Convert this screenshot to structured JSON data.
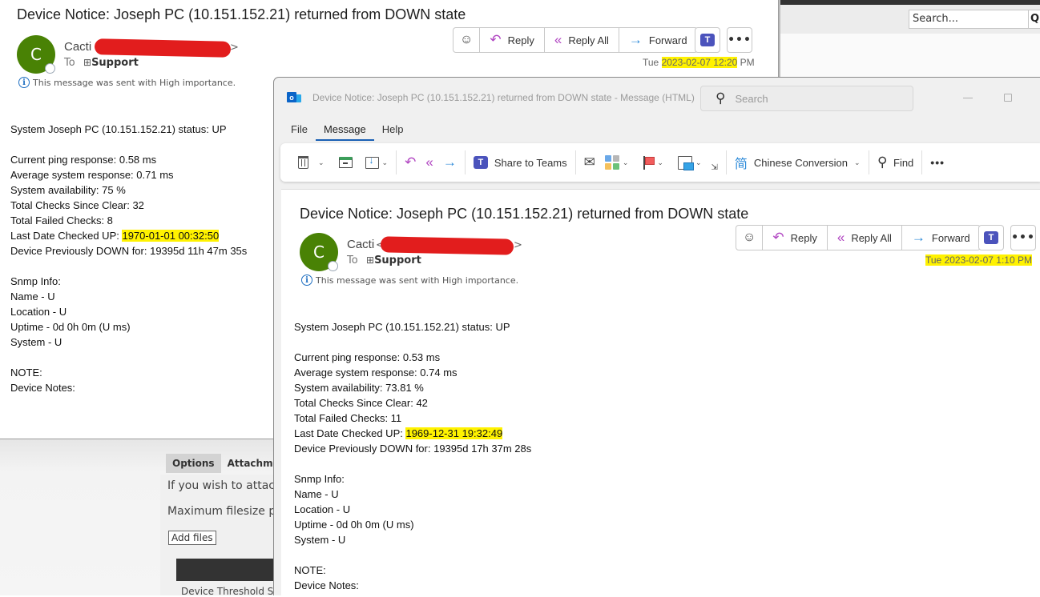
{
  "background_web_page": {
    "search_placeholder": "Search...",
    "search_button_glyph": "Q",
    "tabs": [
      "Options",
      "Attachments"
    ],
    "attach_text": "If you wish to attach",
    "filesize_text": "Maximum filesize pe",
    "add_files_label": "Add files",
    "threshold_text": "Device Threshold Se"
  },
  "back_message": {
    "subject": "Device Notice: Joseph PC (10.151.152.21) returned from DOWN state",
    "avatar_initial": "C",
    "sender_name": "Cacti",
    "sender_email_suffix": ">",
    "to_label": "To",
    "recipient_expand": "⊞",
    "recipient": "Support",
    "importance_note": "This message was sent with High importance.",
    "actions": {
      "emoji": "☺",
      "reply": "Reply",
      "reply_all": "Reply All",
      "forward": "Forward",
      "teams": "T",
      "more": "•••"
    },
    "date_prefix": "Tue ",
    "date_highlighted": "2023-02-07 12:20",
    "date_suffix": " PM",
    "body": {
      "status_line": "System Joseph PC (10.151.152.21) status: UP",
      "ping": "Current ping response: 0.58 ms",
      "avg": "Average system response: 0.71 ms",
      "availability": "System availability: 75 %",
      "total_checks": "Total Checks Since Clear: 32",
      "failed_checks": "Total Failed Checks: 8",
      "last_checked_label": "Last Date Checked UP: ",
      "last_checked_value": "1970-01-01 00:32:50",
      "prev_down": "Device Previously DOWN for: 19395d 11h 47m 35s",
      "snmp_header": "Snmp Info:",
      "snmp_name": "Name - U",
      "snmp_location": "Location - U",
      "snmp_uptime": "Uptime - 0d 0h 0m (U ms)",
      "snmp_system": "System - U",
      "note": "NOTE:",
      "device_notes": "Device Notes:"
    }
  },
  "outlook_window": {
    "title": "Device Notice: Joseph PC (10.151.152.21) returned from DOWN state  -  Message (HTML)",
    "search_placeholder": "Search",
    "menu": [
      "File",
      "Message",
      "Help"
    ],
    "active_menu": "Message",
    "ribbon": {
      "share_to_teams": "Share to Teams",
      "chinese_conversion": "Chinese Conversion",
      "find": "Find",
      "more": "•••"
    },
    "message": {
      "subject": "Device Notice: Joseph PC (10.151.152.21) returned from DOWN state",
      "avatar_initial": "C",
      "sender_name": "Cacti",
      "sender_email_prefix": "<",
      "sender_email_suffix": ">",
      "to_label": "To",
      "recipient_expand": "⊞",
      "recipient": "Support",
      "importance_note": "This message was sent with High importance.",
      "actions": {
        "emoji": "☺",
        "reply": "Reply",
        "reply_all": "Reply All",
        "forward": "Forward",
        "teams": "T",
        "more": "•••"
      },
      "date": "Tue 2023-02-07 1:10 PM",
      "body": {
        "status_line": "System Joseph PC (10.151.152.21) status: UP",
        "ping": "Current ping response: 0.53 ms",
        "avg": "Average system response: 0.74 ms",
        "availability": "System availability: 73.81 %",
        "total_checks": "Total Checks Since Clear: 42",
        "failed_checks": "Total Failed Checks: 11",
        "last_checked_label": "Last Date Checked UP: ",
        "last_checked_value": "1969-12-31 19:32:49",
        "prev_down": "Device Previously DOWN for: 19395d 17h 37m 28s",
        "snmp_header": "Snmp Info:",
        "snmp_name": "Name - U",
        "snmp_location": "Location - U",
        "snmp_uptime": "Uptime - 0d 0h 0m (U ms)",
        "snmp_system": "System - U",
        "note": "NOTE:",
        "device_notes": "Device Notes:"
      }
    }
  },
  "colors": {
    "avatar": "#498205",
    "highlight": "#fff200",
    "redaction": "#e21d1d",
    "reply_accent": "#b146c2",
    "forward_accent": "#2c8ad9",
    "teams": "#4b53bc",
    "menu_underline": "#1a5fb4"
  }
}
